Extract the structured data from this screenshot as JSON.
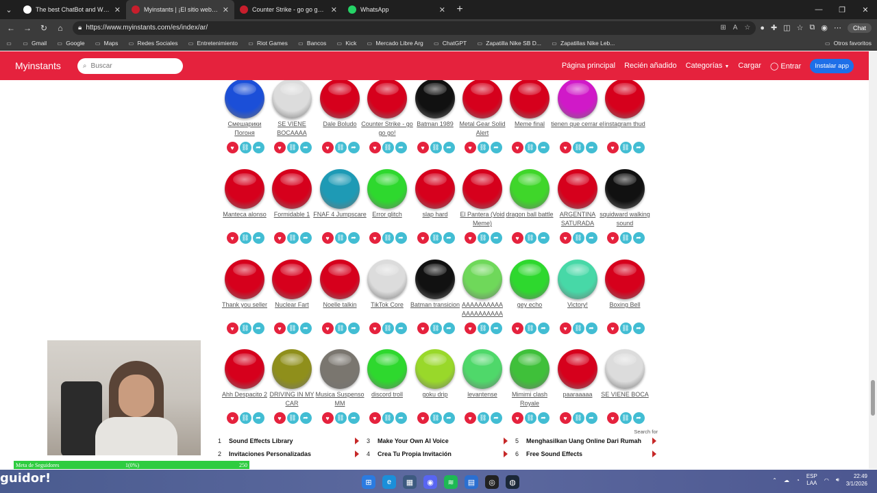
{
  "browser": {
    "tabs": [
      {
        "title": "The best ChatBot and Widgets for",
        "favicon_color": "#ffffff",
        "active": false
      },
      {
        "title": "Myinstants | ¡El sitio web de b",
        "favicon_color": "#c81e2c",
        "active": true
      },
      {
        "title": "Counter Strike - go go go!: botón",
        "favicon_color": "#c81e2c",
        "active": false
      },
      {
        "title": "WhatsApp",
        "favicon_color": "#25d366",
        "active": false
      }
    ],
    "url": "https://www.myinstants.com/es/index/ar/",
    "copilot_label": "Chat",
    "bookmarks": [
      "Gmail",
      "Google",
      "Maps",
      "Redes Sociales",
      "Entretenimiento",
      "Riot Games",
      "Bancos",
      "Kick",
      "Mercado Libre Arg",
      "ChatGPT",
      "Zapatilla Nike SB D...",
      "Zapatillas Nike Leb..."
    ],
    "bookmarks_other": "Otros favoritos"
  },
  "site": {
    "logo": "Myinstants",
    "search_placeholder": "Buscar",
    "nav": {
      "home": "Página principal",
      "recent": "Recién añadido",
      "categories": "Categorías",
      "upload": "Cargar",
      "login": "Entrar",
      "install": "Instalar app"
    }
  },
  "instants": [
    {
      "name": "Смешарики Погоня",
      "color": "#1b4fd8"
    },
    {
      "name": "SE VIENE BOCAAAA",
      "color": "#dcdcdc"
    },
    {
      "name": "Dale Boludo",
      "color": "#d6001c"
    },
    {
      "name": "Counter Strike - go go go!",
      "color": "#d6001c"
    },
    {
      "name": "Batman 1989",
      "color": "#111111"
    },
    {
      "name": "Metal Gear Solid Alert",
      "color": "#d6001c"
    },
    {
      "name": "Meme final",
      "color": "#d6001c"
    },
    {
      "name": "tienen que cerrar el",
      "color": "#d019c8"
    },
    {
      "name": "instagram thud",
      "color": "#d6001c"
    },
    {
      "name": "Manteca alonso",
      "color": "#d6001c"
    },
    {
      "name": "Formidable 1",
      "color": "#d6001c"
    },
    {
      "name": "FNAF 4 Jumpscare",
      "color": "#1e9ab5"
    },
    {
      "name": "Error glitch",
      "color": "#2ed82e"
    },
    {
      "name": "slap hard",
      "color": "#d6001c"
    },
    {
      "name": "El Pantera (Void Meme)",
      "color": "#d6001c"
    },
    {
      "name": "dragon ball battle",
      "color": "#3fd62a"
    },
    {
      "name": "ARGENTINA SATURADA",
      "color": "#d6001c"
    },
    {
      "name": "squidward walking sound",
      "color": "#111111"
    },
    {
      "name": "Thank you seller",
      "color": "#d6001c"
    },
    {
      "name": "Nuclear Fart",
      "color": "#d6001c"
    },
    {
      "name": "Noelle talkin",
      "color": "#d6001c"
    },
    {
      "name": "TikTok Core",
      "color": "#dcdcdc"
    },
    {
      "name": "Batman transicion",
      "color": "#111111"
    },
    {
      "name": "AAAAAAAAAA AAAAAAAAAA",
      "color": "#6fd85a"
    },
    {
      "name": "gey echo",
      "color": "#2ed82e"
    },
    {
      "name": "Victory!",
      "color": "#47d8a7"
    },
    {
      "name": "Boxing Bell",
      "color": "#d6001c"
    },
    {
      "name": "Ahh Despacito 2",
      "color": "#d6001c"
    },
    {
      "name": "DRIVING IN MY CAR",
      "color": "#8f8f1b"
    },
    {
      "name": "Musica Suspenso MM",
      "color": "#7a766f"
    },
    {
      "name": "discord troll",
      "color": "#2ed82e"
    },
    {
      "name": "goku drip",
      "color": "#99d82a"
    },
    {
      "name": "levantense",
      "color": "#4fd86a"
    },
    {
      "name": "Mimimi clash Royale",
      "color": "#3fc03a"
    },
    {
      "name": "paaraaaaa",
      "color": "#d6001c"
    },
    {
      "name": "SE VIENE BOCA",
      "color": "#dcdcdc"
    }
  ],
  "ads": {
    "search_for": "Search for",
    "items": [
      {
        "n": "1",
        "label": "Sound Effects Library"
      },
      {
        "n": "2",
        "label": "Invitaciones Personalizadas"
      },
      {
        "n": "3",
        "label": "Make Your Own AI Voice"
      },
      {
        "n": "4",
        "label": "Crea Tu Propia Invitación"
      },
      {
        "n": "5",
        "label": "Menghasilkan Uang Online Dari Rumah"
      },
      {
        "n": "6",
        "label": "Free Sound Effects"
      }
    ]
  },
  "overlay": {
    "meta_label": "Meta de Seguidores",
    "meta_progress": "1(0%)",
    "meta_goal": "250",
    "follow_text": "guidor!"
  },
  "taskbar": {
    "lang_line1": "ESP",
    "lang_line2": "LAA",
    "time": "22:49",
    "date": "3/1/2026"
  }
}
